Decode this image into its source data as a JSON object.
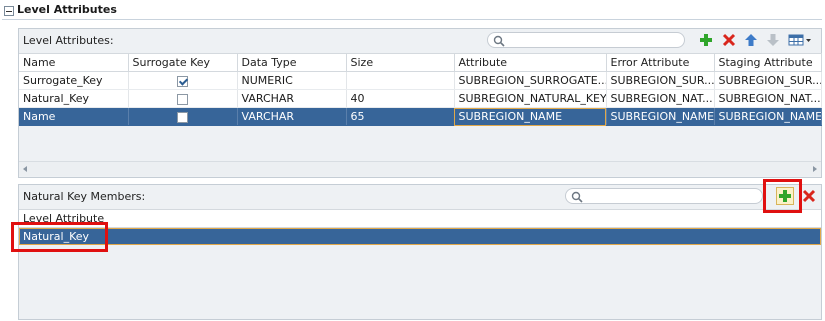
{
  "section": {
    "title": "Level Attributes"
  },
  "attributes_panel": {
    "title": "Level Attributes:",
    "search_placeholder": "",
    "toolbar": [
      {
        "name": "add-icon",
        "label": "Add"
      },
      {
        "name": "delete-icon",
        "label": "Delete"
      },
      {
        "name": "move-up-icon",
        "label": "Move Up"
      },
      {
        "name": "move-down-icon",
        "label": "Move Down"
      },
      {
        "name": "columns-icon",
        "label": "Columns"
      }
    ],
    "columns": [
      "Name",
      "Surrogate Key",
      "Data Type",
      "Size",
      "Attribute",
      "Error Attribute",
      "Staging Attribute"
    ],
    "rows": [
      {
        "name": "Surrogate_Key",
        "surrogate": true,
        "data_type": "NUMERIC",
        "size": "",
        "attribute": "SUBREGION_SURROGATE...",
        "error_attribute": "SUBREGION_SUR...",
        "staging_attribute": "SUBREGION_SUR...",
        "selected": false
      },
      {
        "name": "Natural_Key",
        "surrogate": false,
        "data_type": "VARCHAR",
        "size": "40",
        "attribute": "SUBREGION_NATURAL_KEY",
        "error_attribute": "SUBREGION_NAT...",
        "staging_attribute": "SUBREGION_NAT...",
        "selected": false
      },
      {
        "name": "Name",
        "surrogate": false,
        "data_type": "VARCHAR",
        "size": "65",
        "attribute": "SUBREGION_NAME",
        "error_attribute": "SUBREGION_NAME",
        "staging_attribute": "SUBREGION_NAME",
        "selected": true
      }
    ]
  },
  "natural_key_panel": {
    "title": "Natural Key Members:",
    "search_placeholder": "",
    "column": "Level Attribute",
    "rows": [
      "Natural_Key"
    ]
  },
  "colors": {
    "selection": "#376599",
    "focus_outline": "#e0a84a",
    "add_green": "#2fa52a",
    "delete_red": "#d9261c",
    "callout_red": "#e01010"
  }
}
